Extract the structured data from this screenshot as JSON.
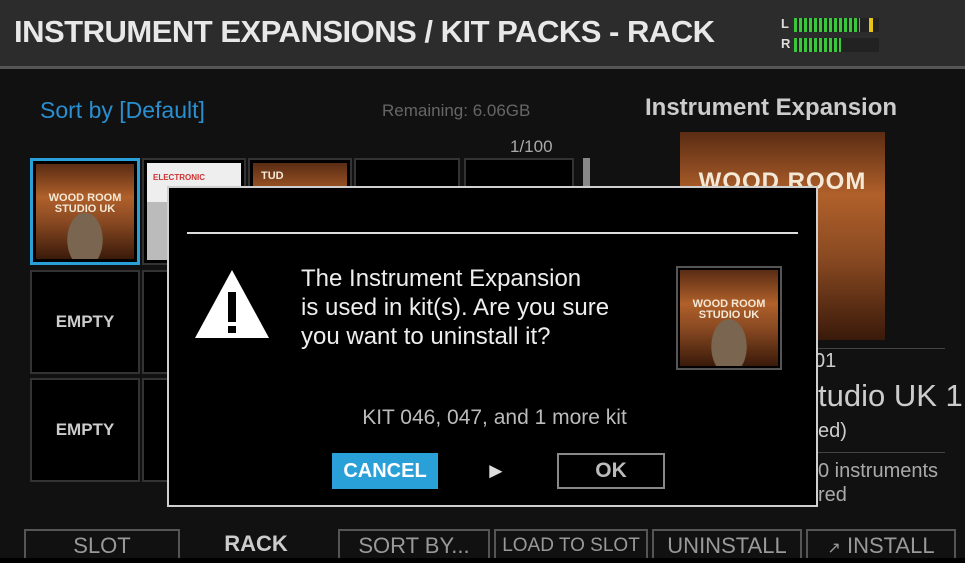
{
  "header": {
    "title": "INSTRUMENT EXPANSIONS / KIT PACKS - RACK",
    "meter": {
      "left_label": "L",
      "right_label": "R",
      "left_level": 0.78,
      "right_level": 0.55,
      "left_peak": 0.88
    }
  },
  "list": {
    "sort_label": "Sort by [Default]",
    "remaining": "Remaining: 6.06GB",
    "page": "1/100",
    "slots": [
      {
        "art_text": "WOOD ROOM STUDIO UK"
      },
      {
        "art_text": "ELECTRONIC"
      },
      {
        "art_text": "TUD"
      },
      {
        "label": "EMPTY"
      },
      {
        "label": "EMPTY"
      }
    ]
  },
  "detail": {
    "heading": "Instrument Expansion",
    "art_text": "WOOD ROOM UK",
    "number_partial": "01",
    "name_partial": "tudio UK 1",
    "status_partial": "ed)",
    "count_partial": "0 instruments",
    "state_partial": "red"
  },
  "dialog": {
    "message_line1": "The Instrument Expansion",
    "message_line2": "is used in kit(s). Are you sure",
    "message_line3": "you want to uninstall it?",
    "thumb_text": "WOOD ROOM STUDIO UK",
    "kits": "KIT 046, 047, and 1 more kit",
    "cancel_label": "CANCEL",
    "arrow": "►",
    "ok_label": "OK"
  },
  "bottom": {
    "slot": "SLOT",
    "rack": "RACK",
    "sort_by": "SORT BY...",
    "load_to_slot": "LOAD TO SLOT",
    "uninstall": "UNINSTALL",
    "install": "INSTALL",
    "install_icon": "external-link-icon"
  },
  "colors": {
    "accent": "#2aa0d8",
    "meter_green": "#39c83a",
    "meter_peak": "#e8c418"
  }
}
